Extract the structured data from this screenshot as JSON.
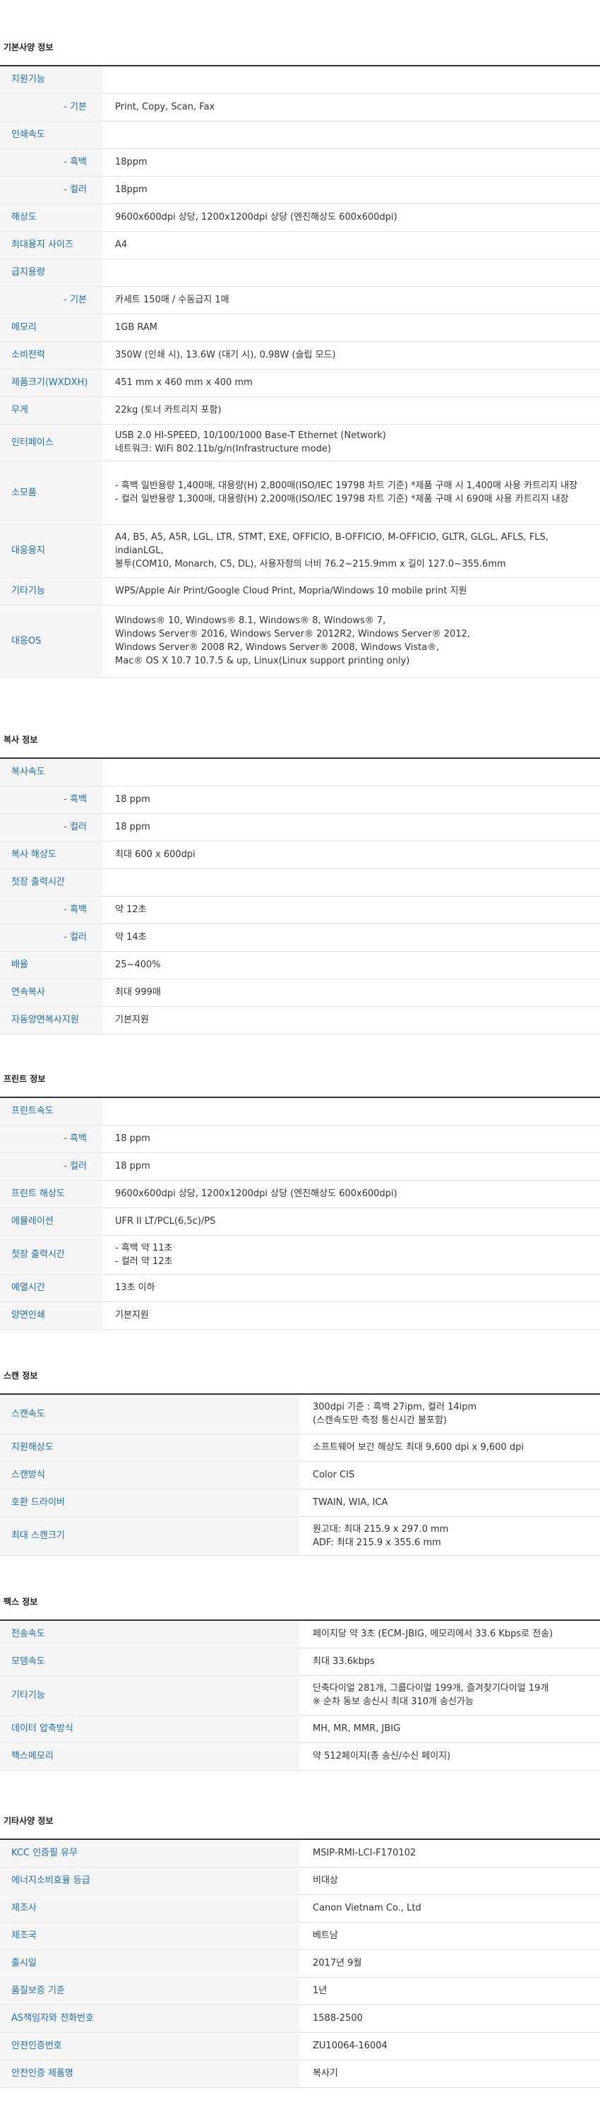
{
  "sections": [
    {
      "id": "basic",
      "title": "기본사양 정보",
      "rows": [
        {
          "label": "지원기능",
          "value": ""
        },
        {
          "label": "- 기본",
          "value": "Print, Copy, Scan, Fax"
        },
        {
          "label": "인쇄속도",
          "value": ""
        },
        {
          "label": "- 흑백",
          "value": "18ppm"
        },
        {
          "label": "- 컬러",
          "value": "18ppm"
        },
        {
          "label": "해상도",
          "value": "9600x600dpi 상당, 1200x1200dpi 상당 (엔진해상도 600x600dpi)"
        },
        {
          "label": "최대용지 사이즈",
          "value": "A4"
        },
        {
          "label": "급지용량",
          "value": ""
        },
        {
          "label": "- 기본",
          "value": "카세트 150매 / 수동급지 1매"
        },
        {
          "label": "메모리",
          "value": "1GB RAM"
        },
        {
          "label": "소비전력",
          "value": "350W (인쇄 시), 13.6W (대기 시), 0.98W (슬립 모드)"
        },
        {
          "label": "제품크기(WXDXH)",
          "value": "451 mm x 460 mm x 400 mm"
        },
        {
          "label": "무게",
          "value": "22kg (토너 카트리지 포함)"
        },
        {
          "label": "인터페이스",
          "value": "USB 2.0 HI-SPEED, 10/100/1000 Base-T Ethernet (Network)\n네트워크: WiFi 802.11b/g/n(Infrastructure mode)"
        },
        {
          "label": "소모품",
          "value": "- 흑백 일반용량 1,400매, 대용량(H) 2,800매(ISO/IEC 19798 차트 기준) *제품 구매 시 1,400매 사용 카트리지 내장\n- 컬러 일반용량 1,300매, 대용량(H) 2,200매(ISO/IEC 19798 차트 기준) *제품 구매 시 690매 사용 카트리지 내장"
        },
        {
          "label": "대응용지",
          "value": "A4, B5, A5, A5R, LGL, LTR, STMT, EXE, OFFICIO, B-OFFICIO, M-OFFICIO, GLTR, GLGL, AFLS, FLS, indianLGL,\n봉투(COM10, Monarch, C5, DL), 사용자정의 너비 76.2~215.9mm x 길이 127.0~355.6mm"
        },
        {
          "label": "기타기능",
          "value": "WPS/Apple Air Print/Google Cloud Print, Mopria/Windows 10 mobile print 지원"
        },
        {
          "label": "대응OS",
          "value": "Windows® 10, Windows® 8.1, Windows® 8, Windows® 7,\nWindows Server® 2016, Windows Server® 2012R2, Windows Server® 2012,\nWindows Server® 2008 R2, Windows Server® 2008, Windows Vista®,\nMac® OS X 10.7 10.7.5 & up, Linux(Linux support printing only)"
        }
      ]
    },
    {
      "id": "copy",
      "title": "복사 정보",
      "rows": [
        {
          "label": "복사속도",
          "value": ""
        },
        {
          "label": "- 흑백",
          "value": "18 ppm"
        },
        {
          "label": "- 컬러",
          "value": "18 ppm"
        },
        {
          "label": "복사 해상도",
          "value": "최대 600 x 600dpi"
        },
        {
          "label": "첫장 출력시간",
          "value": ""
        },
        {
          "label": "- 흑백",
          "value": "약 12초"
        },
        {
          "label": "- 컬러",
          "value": "약 14초"
        },
        {
          "label": "배율",
          "value": "25~400%"
        },
        {
          "label": "연속복사",
          "value": "최대 999매"
        },
        {
          "label": "자동양면복사지원",
          "value": "기본지원"
        }
      ]
    },
    {
      "id": "print",
      "title": "프린트 정보",
      "rows": [
        {
          "label": "프린트속도",
          "value": ""
        },
        {
          "label": "- 흑백",
          "value": "18 ppm"
        },
        {
          "label": "- 컬러",
          "value": "18 ppm"
        },
        {
          "label": "프린트 해상도",
          "value": "9600x600dpi 상당, 1200x1200dpi 상당 (엔진해상도 600x600dpi)"
        },
        {
          "label": "에뮬레이션",
          "value": "UFR II LT/PCL(6,5c)/PS"
        },
        {
          "label": "첫장 출력시간",
          "value": "- 흑백 약 11초\n- 컬러 약 12초"
        },
        {
          "label": "예열시간",
          "value": "13초 이하"
        },
        {
          "label": "양면인쇄",
          "value": "기본지원"
        }
      ]
    },
    {
      "id": "scan",
      "title": "스캔 정보",
      "rows": [
        {
          "label": "스캔속도",
          "value": "300dpi 기준 : 흑백 27ipm, 컬러 14ipm\n(스캔속도만 측정 통신시간 불포함)"
        },
        {
          "label": "지원해상도",
          "value": "소프트웨어 보간 해상도 최대 9,600 dpi x 9,600 dpi"
        },
        {
          "label": "스캔방식",
          "value": "Color CIS"
        },
        {
          "label": "호환 드라이버",
          "value": "TWAIN, WIA, ICA"
        },
        {
          "label": "최대 스캔크기",
          "value": "원고대: 최대 215.9 x 297.0 mm\nADF: 최대 215.9 x 355.6 mm"
        }
      ]
    },
    {
      "id": "fax",
      "title": "팩스 정보",
      "rows": [
        {
          "label": "전송속도",
          "value": "페이지당 약 3초 (ECM-JBIG, 메모리에서 33.6 Kbps로 전송)"
        },
        {
          "label": "모뎀속도",
          "value": "최대 33.6kbps"
        },
        {
          "label": "기타기능",
          "value": "단축다이얼 281개, 그룹다이얼 199개, 즐겨찾기다이얼 19개\n※ 순차 동보 송신시 최대 310개 송신가능"
        },
        {
          "label": "데이터 압축방식",
          "value": "MH, MR, MMR, JBIG"
        },
        {
          "label": "팩스메모리",
          "value": "약 512페이지(총 송신/수신 페이지)"
        }
      ]
    },
    {
      "id": "etc",
      "title": "기타사양 정보",
      "rows": [
        {
          "label": "KCC 인증필 유무",
          "value": "MSIP-RMI-LCI-F170102"
        },
        {
          "label": "에너지소비효율 등급",
          "value": "비대상"
        },
        {
          "label": "제조사",
          "value": "Canon Vietnam Co., Ltd"
        },
        {
          "label": "제조국",
          "value": "베트남"
        },
        {
          "label": "출시일",
          "value": "2017년 9월"
        },
        {
          "label": "품질보증 기준",
          "value": "1년"
        },
        {
          "label": "AS책임자와 전화번호",
          "value": "1588-2500"
        },
        {
          "label": "안전인증번호",
          "value": "ZU10064-16004"
        },
        {
          "label": "안전인증 제품명",
          "value": "복사기"
        }
      ]
    }
  ]
}
